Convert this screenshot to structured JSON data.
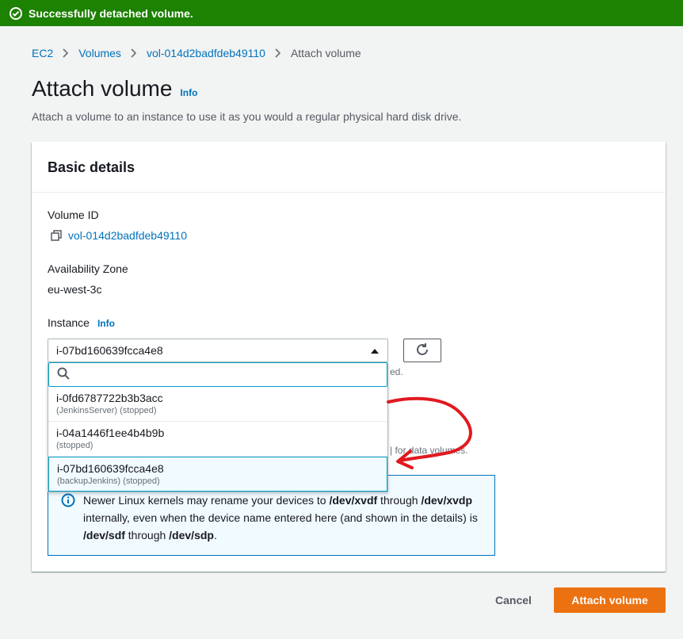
{
  "flash": {
    "message": "Successfully detached volume.",
    "icon": "check-circle-icon",
    "color": "#1d8102"
  },
  "breadcrumb": {
    "items": [
      "EC2",
      "Volumes",
      "vol-014d2badfdeb49110"
    ],
    "current": "Attach volume"
  },
  "page": {
    "title": "Attach volume",
    "info_label": "Info",
    "description": "Attach a volume to an instance to use it as you would a regular physical hard disk drive."
  },
  "panel": {
    "header": "Basic details",
    "volume_id_label": "Volume ID",
    "volume_id_value": "vol-014d2badfdeb49110",
    "az_label": "Availability Zone",
    "az_value": "eu-west-3c",
    "instance_label": "Instance",
    "instance_info": "Info",
    "instance_selected": "i-07bd160639fcca4e8",
    "hint_tail_1": "ed.",
    "hint_tail_2": "| for data volumes."
  },
  "dropdown": {
    "search_placeholder": "",
    "options": [
      {
        "id": "i-0fd6787722b3b3acc",
        "desc": "(JenkinsServer) (stopped)"
      },
      {
        "id": "i-04a1446f1ee4b4b9b",
        "desc": "(stopped)"
      },
      {
        "id": "i-07bd160639fcca4e8",
        "desc": "(backupJenkins) (stopped)"
      }
    ]
  },
  "info_box": {
    "text_1": "Newer Linux kernels may rename your devices to ",
    "code_1": "/dev/xvdf",
    "text_2": " through ",
    "code_2": "/dev/xvdp",
    "text_3": " internally, even when the device name entered here (and shown in the details) is ",
    "code_3": "/dev/sdf",
    "text_4": " through ",
    "code_4": "/dev/sdp",
    "text_5": "."
  },
  "footer": {
    "cancel_label": "Cancel",
    "attach_label": "Attach volume"
  },
  "colors": {
    "accent": "#0073bb",
    "primary_button": "#ec7211",
    "annotation": "#e0191f"
  }
}
